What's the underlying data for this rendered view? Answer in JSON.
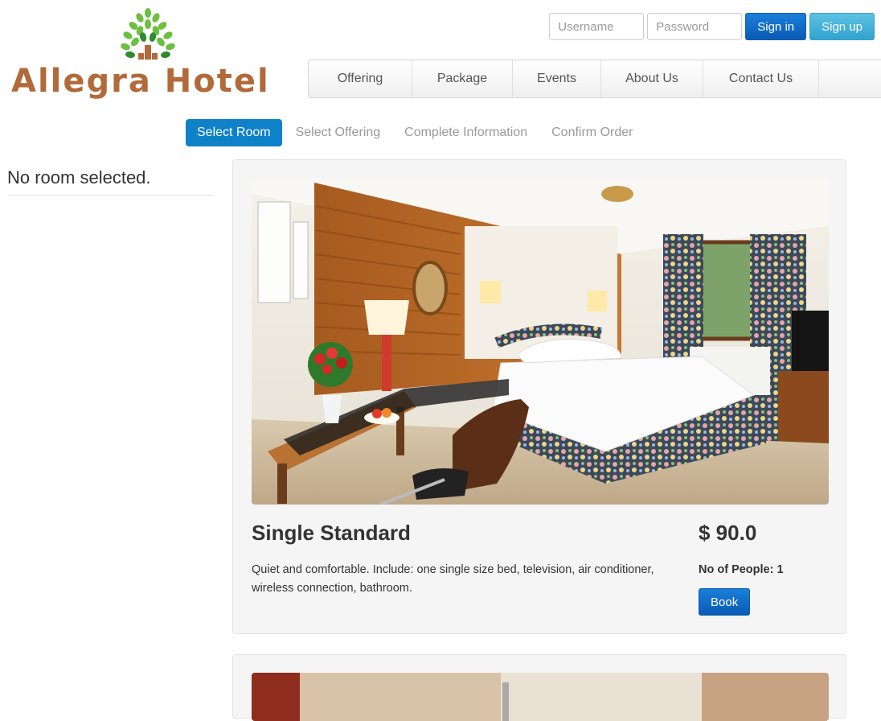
{
  "brand": {
    "name": "Allegra Hotel"
  },
  "auth": {
    "username_placeholder": "Username",
    "password_placeholder": "Password",
    "signin_label": "Sign in",
    "signup_label": "Sign up"
  },
  "nav": {
    "items": [
      {
        "label": "Offering"
      },
      {
        "label": "Package"
      },
      {
        "label": "Events"
      },
      {
        "label": "About Us"
      },
      {
        "label": "Contact Us"
      }
    ]
  },
  "steps": [
    {
      "label": "Select Room",
      "active": true
    },
    {
      "label": "Select Offering",
      "active": false
    },
    {
      "label": "Complete Information",
      "active": false
    },
    {
      "label": "Confirm Order",
      "active": false
    }
  ],
  "sidebar": {
    "message": "No room selected."
  },
  "rooms": [
    {
      "title": "Single Standard",
      "description": "Quiet and comfortable. Include: one single size bed, television, air conditioner, wireless connection, bathroom.",
      "price": "$ 90.0",
      "people": "No of People: 1",
      "book_label": "Book"
    }
  ],
  "colors": {
    "brand_text": "#b26a3a",
    "primary": "#0a5bb5",
    "info": "#31a3cf",
    "step_active": "#0e81c9"
  }
}
